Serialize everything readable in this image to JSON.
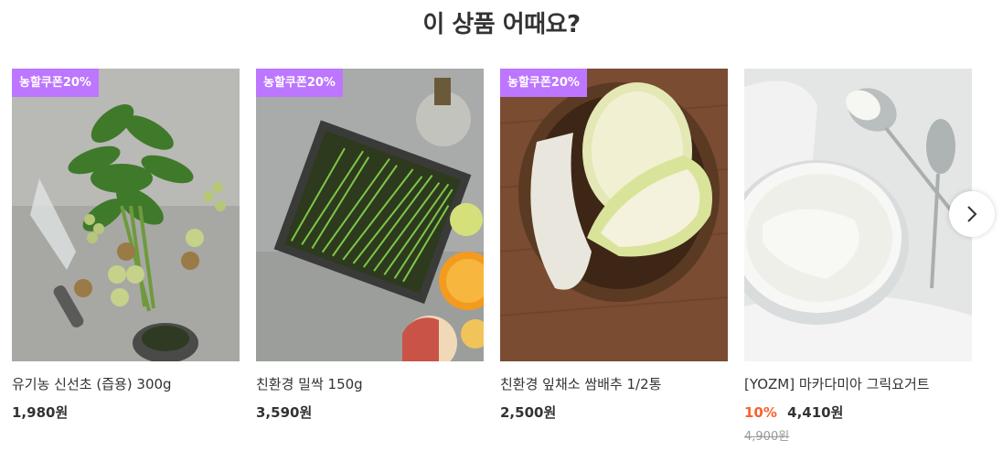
{
  "section": {
    "title": "이 상품 어때요?"
  },
  "products": [
    {
      "badge": "농할쿠폰20%",
      "name": "유기농 신선초 (즙용) 300g",
      "price": "1,980원"
    },
    {
      "badge": "농할쿠폰20%",
      "name": "친환경 밀싹 150g",
      "price": "3,590원"
    },
    {
      "badge": "농할쿠폰20%",
      "name": "친환경 잎채소 쌈배추 1/2통",
      "price": "2,500원"
    },
    {
      "name": "[YOZM] 마카다미아 그릭요거트",
      "discount": "10%",
      "price": "4,410원",
      "original_price": "4,900원"
    }
  ],
  "colors": {
    "badge_bg": "#bd76ff",
    "discount": "#fa622f",
    "text": "#333333",
    "muted": "#999999"
  },
  "icons": {
    "next": "chevron-right-icon"
  }
}
